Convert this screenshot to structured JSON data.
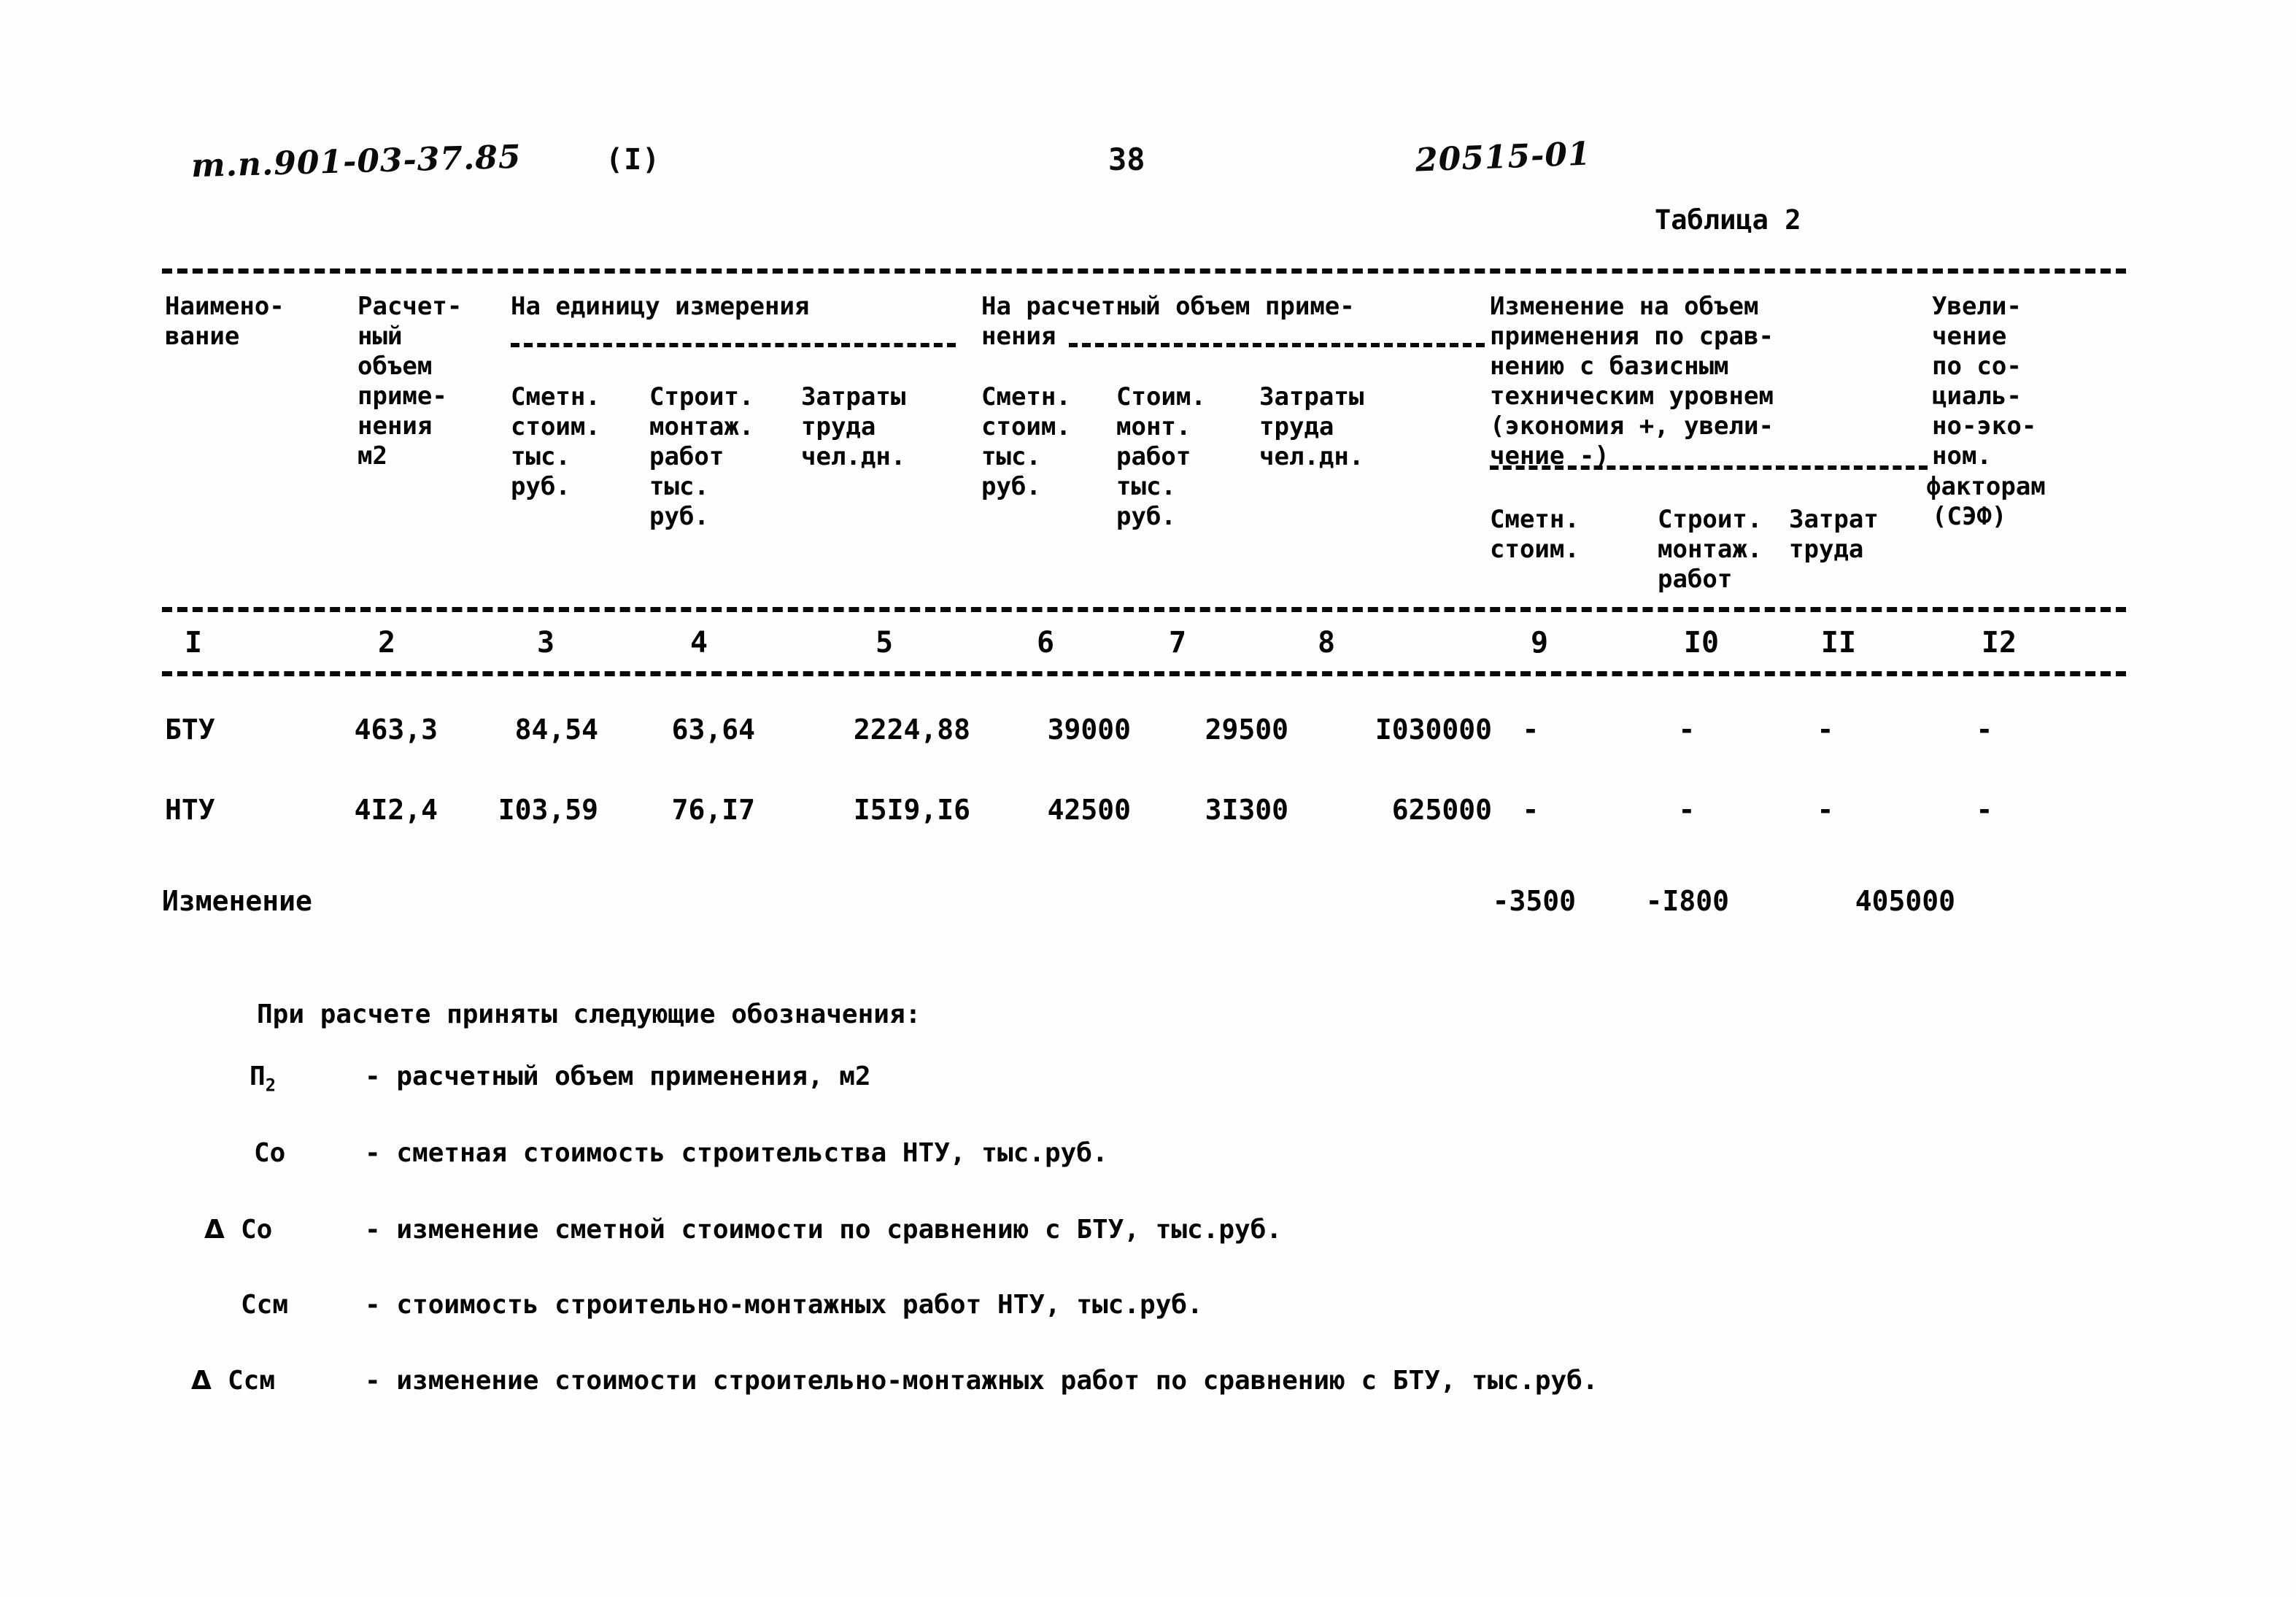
{
  "header": {
    "doc_code": "т.п.901-03-37.85",
    "variant": "(I)",
    "page_number": "38",
    "drawing_number": "20515-01",
    "table_caption": "Таблица 2"
  },
  "table": {
    "columns": [
      {
        "num": "I",
        "title": "Наимено-\nвание"
      },
      {
        "num": "2",
        "title": "Расчет-\nный\nобъем\nприме-\nнения\nм2"
      },
      {
        "num": "3",
        "group": "На единицу измерения",
        "title": "Сметн.\nстоим.\nтыс.\nруб."
      },
      {
        "num": "4",
        "title": "Строит.\nмонтаж.\nработ\nтыс.\nруб."
      },
      {
        "num": "5",
        "title": "Затраты\nтруда\nчел.дн."
      },
      {
        "num": "6",
        "group": "На расчетный объем приме-\nнения",
        "title": "Сметн.\nстоим.\nтыс.\nруб."
      },
      {
        "num": "7",
        "title": "Стоим.\nмонт.\nработ\nтыс.\nруб."
      },
      {
        "num": "8",
        "title": "Затраты\nтруда\nчел.дн."
      },
      {
        "num": "9",
        "group": "Изменение на объем\nприменения по срав-\nнению с базисным\nтехническим уровнем\n(экономия +, увели-\nчение -)",
        "title": "Сметн.\nстоим."
      },
      {
        "num": "I0",
        "title": "Строит.\nмонтаж.\nработ"
      },
      {
        "num": "II",
        "title": "Затрат\nтруда"
      },
      {
        "num": "I2",
        "group": "Увели-\nчение\nпо со-\nциаль-\nно-эко-\nном.\nфакторам\n(СЭФ)",
        "title": ""
      }
    ],
    "group_unit": "На единицу измерения",
    "group_volume_l1": "На расчетный объем приме-",
    "group_volume_l2": "нения",
    "group_change_l1": "Изменение на объем",
    "group_change_l2": "применения по срав-",
    "group_change_l3": "нению с базисным",
    "group_change_l4": "техническим уровнем",
    "group_change_l5": "(экономия +, увели-",
    "group_change_l6": "чение -)",
    "col1_title": "Наимено-\nвание",
    "col2_title": "Расчет-\nный\nобъем\nприме-\nнения\nм2",
    "col3_title": "Сметн.\nстоим.\nтыс.\nруб.",
    "col4_title": "Строит.\nмонтаж.\nработ\nтыс.\nруб.",
    "col5_title": "Затраты\nтруда\nчел.дн.",
    "col6_title": "Сметн.\nстоим.\nтыс.\nруб.",
    "col7_title": "Стоим.\nмонт.\nработ\nтыс.\nруб.",
    "col8_title": "Затраты\nтруда\nчел.дн.",
    "col9_title": "Сметн.\nстоим.",
    "col10_title": "Строит.\nмонтаж.\nработ",
    "col11_title": "Затрат\nтруда",
    "col12_title": "Увели-\nчение\nпо со-\nциаль-\nно-эко-\nном.",
    "col12_title_b": "факторам",
    "col12_title_c": "(СЭФ)",
    "numbers": [
      "I",
      "2",
      "3",
      "4",
      "5",
      "6",
      "7",
      "8",
      "9",
      "I0",
      "II",
      "I2"
    ],
    "rows": [
      {
        "name": "БТУ",
        "values": [
          "463,3",
          "84,54",
          "63,64",
          "2224,88",
          "39000",
          "29500",
          "I030000",
          "-",
          "-",
          "-",
          "-"
        ]
      },
      {
        "name": "НТУ",
        "values": [
          "4I2,4",
          "I03,59",
          "76,I7",
          "I5I9,I6",
          "42500",
          "3I300",
          "625000",
          "-",
          "-",
          "-",
          "-"
        ]
      }
    ],
    "summary": {
      "label": "Изменение",
      "values": [
        "-3500",
        "-I800",
        "405000"
      ]
    }
  },
  "legend": {
    "intro": "При расчете приняты следующие обозначения:",
    "items": [
      {
        "symbol": "П",
        "symbol_sub": "2",
        "symbol_prefix": "",
        "text": "- расчетный объем применения, м2"
      },
      {
        "symbol": "Со",
        "symbol_sub": "",
        "symbol_prefix": "",
        "text": "- сметная стоимость строительства НТУ, тыс.руб."
      },
      {
        "symbol": "Со",
        "symbol_sub": "",
        "symbol_prefix": "Δ",
        "text": "- изменение сметной стоимости по сравнению с БТУ, тыс.руб."
      },
      {
        "symbol": "Ссм",
        "symbol_sub": "",
        "symbol_prefix": "",
        "text": "- стоимость строительно-монтажных работ НТУ, тыс.руб."
      },
      {
        "symbol": "Ссм",
        "symbol_sub": "",
        "symbol_prefix": "Δ",
        "text": "- изменение стоимости строительно-монтажных работ по сравнению с БТУ, тыс.руб."
      }
    ]
  }
}
